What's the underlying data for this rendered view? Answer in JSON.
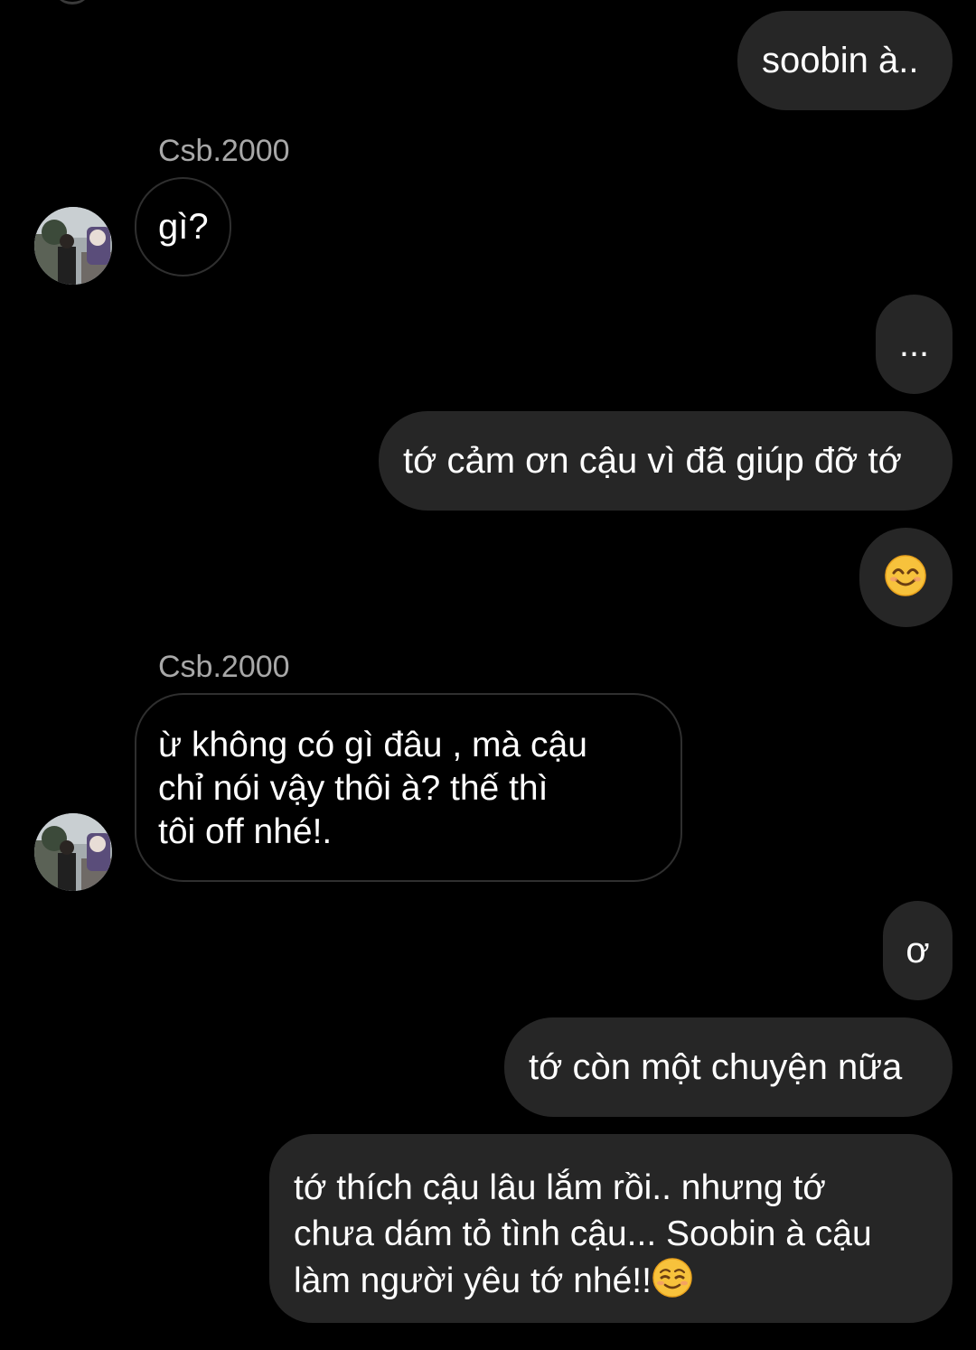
{
  "contact": {
    "username": "Csb.2000",
    "avatar_icon": "profile-photo-avatar"
  },
  "messages": [
    {
      "from": "me",
      "text": "soobin à.."
    },
    {
      "from": "them",
      "sender": "Csb.2000",
      "text": "gì?"
    },
    {
      "from": "me",
      "text": "..."
    },
    {
      "from": "me",
      "text": "tớ cảm ơn cậu vì đã giúp đỡ tớ"
    },
    {
      "from": "me",
      "text": "",
      "emoji": "smiling-face-emoji"
    },
    {
      "from": "them",
      "sender": "Csb.2000",
      "lines": [
        "ừ không có gì đâu , mà cậu",
        "chỉ nói vậy thôi à? thế thì",
        "tôi off nhé!."
      ]
    },
    {
      "from": "me",
      "text": "ơ"
    },
    {
      "from": "me",
      "text": "tớ còn một chuyện nữa"
    },
    {
      "from": "me",
      "lines": [
        "tớ thích cậu lâu lắm rồi.. nhưng tớ",
        "chưa dám tỏ tình cậu... Soobin à cậu",
        "làm người yêu tớ nhé!!"
      ],
      "trailing_emoji": "relieved-smile-emoji"
    }
  ],
  "colors": {
    "background": "#000000",
    "outgoing_bubble": "#262626",
    "incoming_border": "#2f2f2f",
    "sender_label": "#a8a8a8",
    "text": "#ffffff",
    "emoji_yellow": "#f7c23c"
  }
}
